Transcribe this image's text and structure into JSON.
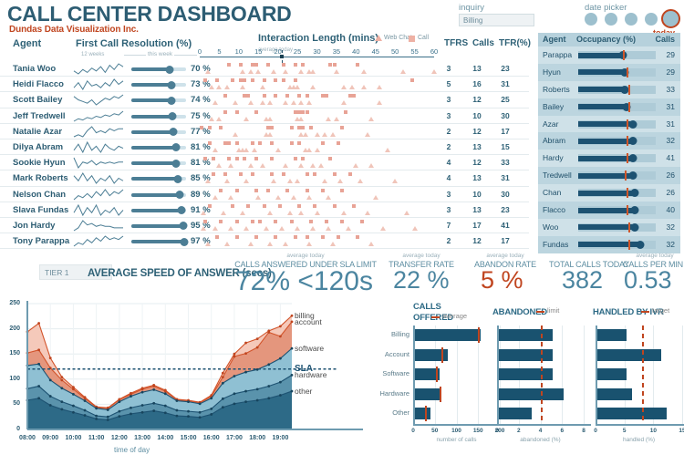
{
  "header": {
    "title": "CALL CENTER DASHBOARD",
    "subtitle": "Dundas Data Visualization Inc.",
    "inquiry_label": "inquiry",
    "inquiry_value": "Billing",
    "datepicker_label": "date picker",
    "today_label": "today"
  },
  "columns": {
    "agent": "Agent",
    "fcr": "First Call Resolution (%)",
    "interaction": "Interaction Length (mins)",
    "tfrs": "TFRS",
    "calls": "Calls",
    "tfr": "TFR(%)",
    "sparkline_left": "12 weeks",
    "sparkline_right": "this week",
    "avg_today": "average today",
    "legend_webchat": "Web Chat",
    "legend_call": "Call"
  },
  "interaction_axis": {
    "ticks": [
      0,
      5,
      10,
      15,
      20,
      25,
      30,
      35,
      40,
      45,
      50,
      55,
      60
    ],
    "average_today": 21
  },
  "agents": [
    {
      "name": "Tania Woo",
      "fcr": 70,
      "tfrs": 3,
      "calls": 13,
      "tfr": 23,
      "spark": [
        5,
        3,
        6,
        4,
        7,
        5,
        8,
        4,
        9,
        6,
        10,
        8
      ],
      "calls_pts": [
        7,
        10,
        13,
        14,
        17,
        21,
        24,
        26,
        33,
        34,
        40
      ],
      "chat_pts": [
        2,
        11,
        13,
        15,
        19,
        22,
        26,
        28,
        29,
        35,
        42,
        52,
        60
      ]
    },
    {
      "name": "Heidi Flacco",
      "fcr": 73,
      "tfrs": 5,
      "calls": 16,
      "tfr": 31,
      "spark": [
        4,
        7,
        3,
        8,
        5,
        6,
        4,
        7,
        5,
        9,
        6,
        8
      ],
      "calls_pts": [
        1,
        4,
        8,
        10,
        11,
        13,
        16,
        19,
        21,
        24,
        54
      ],
      "chat_pts": [
        3,
        5,
        7,
        11,
        16,
        23,
        24,
        25,
        29,
        37,
        39,
        42,
        46
      ]
    },
    {
      "name": "Scott Bailey",
      "fcr": 74,
      "tfrs": 3,
      "calls": 12,
      "tfr": 25,
      "spark": [
        8,
        6,
        5,
        4,
        6,
        3,
        5,
        7,
        6,
        8,
        7,
        9
      ],
      "calls_pts": [
        6,
        11,
        12,
        16,
        19,
        22,
        25,
        27,
        31,
        32,
        38,
        39
      ],
      "chat_pts": [
        4,
        9,
        13,
        16,
        18,
        22,
        24,
        26,
        28,
        37,
        46
      ]
    },
    {
      "name": "Jeff Tredwell",
      "fcr": 75,
      "tfrs": 3,
      "calls": 10,
      "tfr": 30,
      "spark": [
        3,
        5,
        4,
        6,
        5,
        7,
        6,
        8,
        7,
        9,
        8,
        11
      ],
      "calls_pts": [
        6,
        9,
        14,
        24,
        25,
        26,
        27,
        37
      ],
      "chat_pts": [
        3,
        5,
        12,
        17,
        18,
        25,
        26,
        33,
        35,
        44
      ]
    },
    {
      "name": "Natalie Azar",
      "fcr": 77,
      "tfrs": 2,
      "calls": 12,
      "tfr": 17,
      "spark": [
        3,
        4,
        3,
        6,
        8,
        5,
        6,
        5,
        7,
        6,
        7,
        7
      ],
      "calls_pts": [
        0,
        2,
        5,
        17,
        18,
        23,
        25,
        26,
        28,
        36
      ],
      "chat_pts": [
        9,
        17,
        18,
        26,
        27,
        30,
        32,
        34,
        43
      ]
    },
    {
      "name": "Dilya Abram",
      "fcr": 81,
      "tfrs": 2,
      "calls": 13,
      "tfr": 15,
      "spark": [
        5,
        8,
        4,
        9,
        5,
        7,
        4,
        8,
        6,
        5,
        7,
        6
      ],
      "calls_pts": [
        2,
        6,
        7,
        9,
        13,
        15,
        18,
        23,
        25,
        31,
        35
      ],
      "chat_pts": [
        4,
        10,
        11,
        12,
        14,
        20,
        27,
        28,
        30,
        48
      ]
    },
    {
      "name": "Sookie Hyun",
      "fcr": 81,
      "tfrs": 4,
      "calls": 12,
      "tfr": 33,
      "spark": [
        9,
        2,
        6,
        5,
        7,
        4,
        6,
        5,
        6,
        5,
        6,
        6
      ],
      "calls_pts": [
        1,
        3,
        7,
        9,
        11,
        14,
        18,
        24,
        26,
        33
      ],
      "chat_pts": [
        5,
        8,
        13,
        16,
        22,
        26,
        29,
        31,
        40,
        44
      ]
    },
    {
      "name": "Mark Roberts",
      "fcr": 85,
      "tfrs": 4,
      "calls": 13,
      "tfr": 31,
      "spark": [
        7,
        5,
        8,
        5,
        7,
        4,
        6,
        5,
        7,
        4,
        6,
        5
      ],
      "calls_pts": [
        3,
        6,
        10,
        13,
        18,
        21,
        27,
        29,
        34,
        38
      ],
      "chat_pts": [
        2,
        7,
        12,
        19,
        23,
        25,
        32,
        36,
        41,
        50
      ]
    },
    {
      "name": "Nelson Chan",
      "fcr": 89,
      "tfrs": 3,
      "calls": 10,
      "tfr": 30,
      "spark": [
        4,
        6,
        5,
        7,
        5,
        8,
        6,
        9,
        6,
        8,
        7,
        9
      ],
      "calls_pts": [
        5,
        9,
        14,
        17,
        22,
        27,
        31,
        36
      ],
      "chat_pts": [
        4,
        8,
        15,
        20,
        24,
        28,
        33,
        45
      ]
    },
    {
      "name": "Slava Fundas",
      "fcr": 91,
      "tfrs": 3,
      "calls": 13,
      "tfr": 23,
      "spark": [
        6,
        9,
        5,
        8,
        6,
        9,
        5,
        7,
        6,
        8,
        5,
        7
      ],
      "calls_pts": [
        2,
        8,
        12,
        16,
        20,
        25,
        29,
        34,
        39
      ],
      "chat_pts": [
        1,
        6,
        11,
        18,
        23,
        26,
        30,
        37,
        43,
        53
      ]
    },
    {
      "name": "Jon Hardy",
      "fcr": 95,
      "tfrs": 7,
      "calls": 17,
      "tfr": 41,
      "spark": [
        4,
        6,
        11,
        8,
        9,
        7,
        8,
        7,
        7,
        6,
        6,
        6
      ],
      "calls_pts": [
        1,
        5,
        9,
        13,
        15,
        19,
        23,
        28,
        32,
        36,
        41
      ],
      "chat_pts": [
        1,
        4,
        8,
        12,
        17,
        21,
        25,
        29,
        33,
        38,
        47,
        55
      ]
    },
    {
      "name": "Tony Parappa",
      "fcr": 97,
      "tfrs": 2,
      "calls": 12,
      "tfr": 17,
      "spark": [
        3,
        5,
        4,
        7,
        5,
        8,
        6,
        9,
        7,
        8,
        7,
        9
      ],
      "calls_pts": [
        4,
        9,
        14,
        19,
        24,
        27,
        31,
        35,
        40
      ],
      "chat_pts": [
        2,
        7,
        13,
        18,
        22,
        28,
        34,
        44
      ]
    }
  ],
  "occupancy": {
    "header_agent": "Agent",
    "header_occupancy": "Occupancy (%)",
    "header_calls": "Calls",
    "rows": [
      {
        "name": "Parappa",
        "occupancy": 83,
        "marker": 83,
        "calls": 29
      },
      {
        "name": "Hyun",
        "occupancy": 84,
        "marker": 85,
        "calls": 29
      },
      {
        "name": "Roberts",
        "occupancy": 84,
        "marker": 86,
        "calls": 33
      },
      {
        "name": "Bailey",
        "occupancy": 85,
        "marker": 86,
        "calls": 31
      },
      {
        "name": "Azar",
        "occupancy": 88,
        "marker": 85,
        "calls": 31
      },
      {
        "name": "Abram",
        "occupancy": 88,
        "marker": 85,
        "calls": 32
      },
      {
        "name": "Hardy",
        "occupancy": 88,
        "marker": 85,
        "calls": 41
      },
      {
        "name": "Tredwell",
        "occupancy": 88,
        "marker": 84,
        "calls": 26
      },
      {
        "name": "Chan",
        "occupancy": 89,
        "marker": 85,
        "calls": 26
      },
      {
        "name": "Flacco",
        "occupancy": 89,
        "marker": 85,
        "calls": 40
      },
      {
        "name": "Woo",
        "occupancy": 89,
        "marker": 86,
        "calls": 32
      },
      {
        "name": "Fundas",
        "occupancy": 92,
        "marker": 86,
        "calls": 32
      }
    ]
  },
  "kpis": {
    "tier": "TIER 1",
    "asa_title": "AVERAGE SPEED OF ANSWER (secs)",
    "avg_today": "average today",
    "sla": {
      "label": "CALLS ANSWERED UNDER SLA LIMIT",
      "percent": "72%",
      "limit": "<120s"
    },
    "transfer_rate": {
      "label": "TRANSFER RATE",
      "value": "22 %"
    },
    "abandon_rate": {
      "label": "ABANDON RATE",
      "value": "5 %"
    },
    "total_calls": {
      "label": "TOTAL CALLS TODAY",
      "value": "382"
    },
    "calls_per_min": {
      "label": "CALLS PER MIN",
      "value": "0.53"
    }
  },
  "chart_data": [
    {
      "type": "area",
      "name": "average-speed-of-answer",
      "title": "AVERAGE SPEED OF ANSWER (secs)",
      "xlabel": "time of day",
      "ylabel": "",
      "ylim": [
        0,
        250
      ],
      "yticks": [
        0,
        50,
        100,
        150,
        200,
        250
      ],
      "grid": true,
      "sla_line": {
        "label": "SLA",
        "value": 120
      },
      "x": [
        "08:00",
        "08:30",
        "09:00",
        "09:30",
        "10:00",
        "10:30",
        "11:00",
        "11:30",
        "12:00",
        "12:30",
        "13:00",
        "13:30",
        "14:00",
        "14:30",
        "15:00",
        "15:30",
        "16:00",
        "16:30",
        "17:00",
        "17:30",
        "18:00",
        "18:30",
        "19:00",
        "19:30"
      ],
      "xticks": [
        "08:00",
        "09:00",
        "10:00",
        "11:00",
        "12:00",
        "13:00",
        "14:00",
        "15:00",
        "16:00",
        "17:00",
        "18:00",
        "19:00"
      ],
      "stacked": true,
      "series": [
        {
          "name": "other",
          "color": "#2d6a87",
          "values": [
            58,
            62,
            48,
            40,
            34,
            28,
            21,
            19,
            26,
            31,
            34,
            37,
            33,
            27,
            26,
            24,
            30,
            44,
            51,
            55,
            58,
            62,
            68,
            76
          ]
        },
        {
          "name": "hardware",
          "color": "#5a93ac",
          "values": [
            81,
            86,
            66,
            55,
            47,
            38,
            27,
            25,
            36,
            43,
            48,
            52,
            47,
            38,
            36,
            34,
            41,
            61,
            71,
            76,
            80,
            86,
            94,
            108
          ]
        },
        {
          "name": "software",
          "color": "#8fc0d3",
          "values": [
            127,
            130,
            98,
            82,
            70,
            57,
            42,
            39,
            55,
            66,
            74,
            79,
            71,
            57,
            55,
            51,
            62,
            92,
            106,
            114,
            119,
            129,
            141,
            161
          ]
        },
        {
          "name": "account",
          "color": "#e08d72",
          "values": [
            152,
            158,
            122,
            98,
            80,
            62,
            44,
            42,
            59,
            70,
            80,
            86,
            76,
            59,
            57,
            53,
            66,
            104,
            145,
            151,
            163,
            193,
            185,
            214
          ]
        },
        {
          "name": "billing",
          "color": "#f3bfae",
          "values": [
            194,
            211,
            142,
            104,
            84,
            64,
            45,
            43,
            60,
            72,
            82,
            88,
            78,
            60,
            58,
            54,
            68,
            112,
            150,
            172,
            180,
            196,
            205,
            226
          ]
        }
      ],
      "series_labels": [
        "billing",
        "account",
        "software",
        "hardware",
        "other"
      ]
    },
    {
      "type": "bar",
      "name": "calls-offered",
      "title": "CALLS",
      "subtitle": "OFFERED",
      "legend": "average",
      "orientation": "horizontal",
      "categories": [
        "Billing",
        "Account",
        "Software",
        "Hardware",
        "Other"
      ],
      "values": [
        152,
        76,
        57,
        62,
        35
      ],
      "reference": [
        150,
        65,
        52,
        60,
        28
      ],
      "xlabel": "number of calls",
      "xlim": [
        0,
        200
      ],
      "xticks": [
        0,
        50,
        100,
        150,
        200
      ]
    },
    {
      "type": "bar",
      "name": "abandoned",
      "title": "ABANDONED",
      "legend": "limit",
      "orientation": "horizontal",
      "categories": [
        "Billing",
        "Account",
        "Software",
        "Hardware",
        "Other"
      ],
      "values": [
        5,
        5,
        5,
        6,
        3
      ],
      "reference_line": 4,
      "xlabel": "abandoned (%)",
      "xlim": [
        0,
        8
      ],
      "xticks": [
        0,
        2,
        4,
        6,
        8
      ]
    },
    {
      "type": "bar",
      "name": "handled-by-ivr",
      "title": "HANDLED BY IVR",
      "legend": "target",
      "orientation": "horizontal",
      "categories": [
        "Billing",
        "Account",
        "Software",
        "Hardware",
        "Other"
      ],
      "values": [
        5,
        11,
        5,
        6,
        12
      ],
      "reference_line": 8,
      "xlabel": "handled (%)",
      "xlim": [
        0,
        15
      ],
      "xticks": [
        0,
        5,
        10,
        15
      ]
    }
  ],
  "colors": {
    "primary": "#2d5d73",
    "accent": "#c0451f",
    "bar": "#19526f",
    "panel": "#b6d1dc"
  }
}
